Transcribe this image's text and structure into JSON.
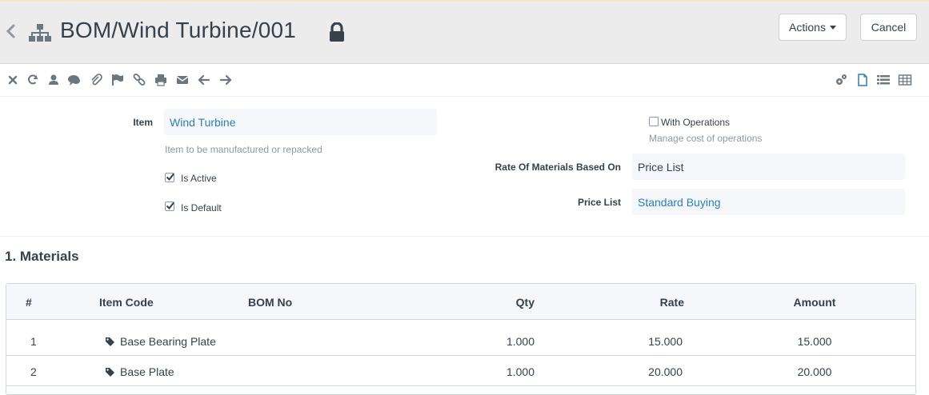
{
  "header": {
    "title": "BOM/Wind Turbine/001",
    "actions_label": "Actions",
    "cancel_label": "Cancel"
  },
  "form": {
    "item_label": "Item",
    "item_value": "Wind Turbine",
    "item_help": "Item to be manufactured or repacked",
    "is_active_label": "Is Active",
    "is_active": true,
    "is_default_label": "Is Default",
    "is_default": true,
    "with_operations_label": "With Operations",
    "with_operations": false,
    "with_operations_help": "Manage cost of operations",
    "rate_based_on_label": "Rate Of Materials Based On",
    "rate_based_on_value": "Price List",
    "price_list_label": "Price List",
    "price_list_value": "Standard Buying"
  },
  "materials": {
    "section_title": "1. Materials",
    "columns": {
      "idx": "#",
      "item_code": "Item Code",
      "bom_no": "BOM No",
      "qty": "Qty",
      "rate": "Rate",
      "amount": "Amount"
    },
    "rows": [
      {
        "idx": "1",
        "item_code": "Base Bearing Plate",
        "bom_no": "",
        "qty": "1.000",
        "rate": "15.000",
        "amount": "15.000"
      },
      {
        "idx": "2",
        "item_code": "Base Plate",
        "bom_no": "",
        "qty": "1.000",
        "rate": "20.000",
        "amount": "20.000"
      }
    ]
  },
  "toolbar": {
    "icons": [
      "close-icon",
      "refresh-icon",
      "user-icon",
      "comment-icon",
      "attachment-icon",
      "flag-icon",
      "link-icon",
      "print-icon",
      "email-icon",
      "arrow-left-icon",
      "arrow-right-icon",
      "settings-icon",
      "form-view-icon",
      "list-view-icon",
      "report-view-icon"
    ]
  },
  "colors": {
    "link": "#2b7ec2",
    "text": "#36414c",
    "muted": "#8d99a6",
    "header_bg": "#ececec",
    "field_bg": "#f5f7fa"
  }
}
